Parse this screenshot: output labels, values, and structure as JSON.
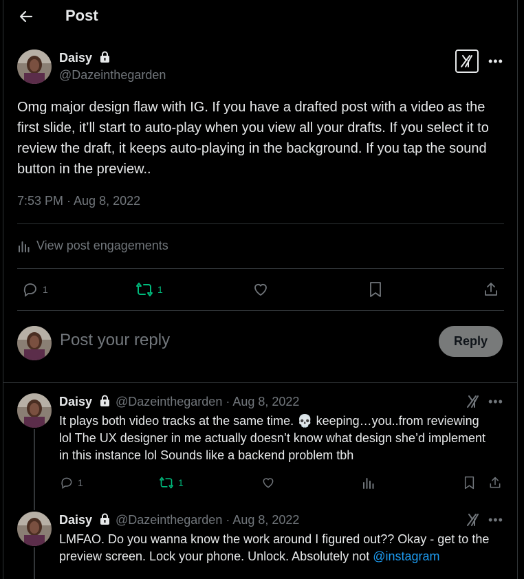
{
  "header": {
    "title": "Post"
  },
  "main_post": {
    "name": "Daisy",
    "handle": "@Dazeinthegarden",
    "text": "Omg major design flaw with IG. If you have a drafted post with a video as the first slide, it’ll start to auto-play when you view all your drafts. If you select it to review the draft, it keeps auto-playing in the background. If you tap the sound button in the preview..",
    "timestamp": "7:53 PM · Aug 8, 2022",
    "engagements_label": "View post engagements",
    "actions": {
      "replies": "1",
      "reposts": "1"
    }
  },
  "reply_box": {
    "placeholder": "Post your reply",
    "button": "Reply"
  },
  "replies": [
    {
      "name": "Daisy",
      "handle_date": "@Dazeinthegarden · Aug 8, 2022",
      "text": "It plays both video tracks at the same time. 💀 keeping…you..from reviewing lol The UX designer in me actually doesn’t know what design she’d implement in this instance lol Sounds like a backend problem tbh",
      "replies": "1",
      "reposts": "1"
    },
    {
      "name": "Daisy",
      "handle_date": "@Dazeinthegarden · Aug 8, 2022",
      "text": "LMFAO. Do you wanna know the work around I figured out?? Okay - get to the preview screen. Lock your phone. Unlock. Absolutely not ",
      "mention": "@instagram"
    }
  ],
  "colors": {
    "repost_green": "#00ba7c",
    "link_blue": "#1d9bf0",
    "muted": "#71767b"
  }
}
